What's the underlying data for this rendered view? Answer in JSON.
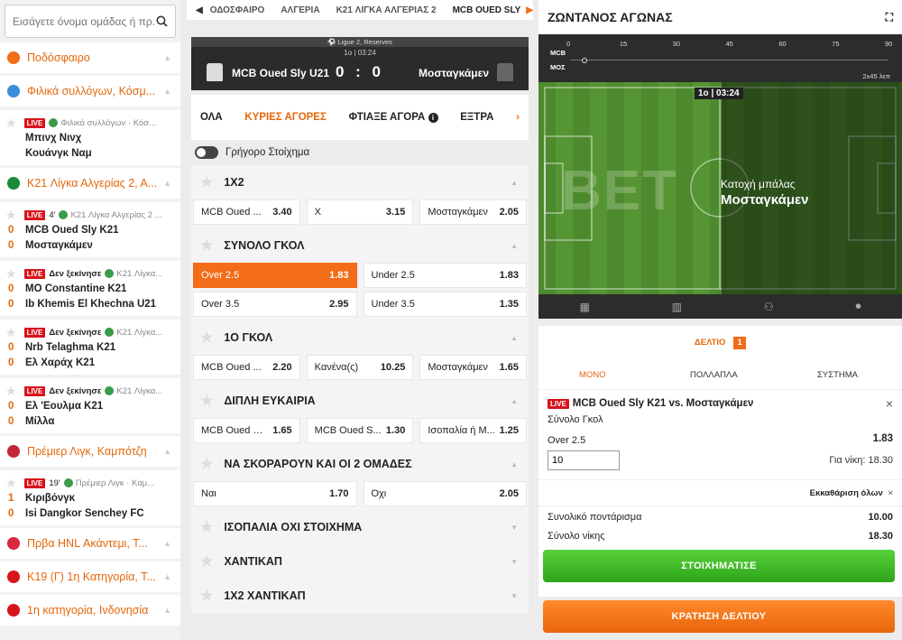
{
  "search": {
    "placeholder": "Εισάγετε όνομα ομάδας ή πρ..."
  },
  "sidebar": [
    {
      "type": "head",
      "label": "Ποδόσφαιρο",
      "color": "#f36c17"
    },
    {
      "type": "head",
      "label": "Φιλικά συλλόγων, Κόσμ...",
      "color": "#3a8fd9"
    },
    {
      "type": "match",
      "live": "LIVE",
      "status": "",
      "minute": "",
      "league": "Φιλικά συλλόγων · Κόσ...",
      "teams": [
        {
          "score": "",
          "name": "Μπινχ Νινχ"
        },
        {
          "score": "",
          "name": "Κουάνγκ Ναμ"
        }
      ]
    },
    {
      "type": "head",
      "label": "K21 Λίγκα Αλγερίας 2, Α...",
      "color": "#1a8a3a"
    },
    {
      "type": "match",
      "live": "LIVE",
      "status": "",
      "minute": "4'",
      "league": "K21 Λίγκα Αλγερίας 2 ...",
      "teams": [
        {
          "score": "0",
          "name": "MCB Oued Sly K21"
        },
        {
          "score": "0",
          "name": "Μοσταγκάμεν"
        }
      ]
    },
    {
      "type": "match",
      "live": "LIVE",
      "status": "Δεν ξεκίνησε",
      "minute": "",
      "league": "K21 Λίγκα...",
      "teams": [
        {
          "score": "0",
          "name": "MO Constantine K21"
        },
        {
          "score": "0",
          "name": "Ib Khemis El Khechna U21"
        }
      ]
    },
    {
      "type": "match",
      "live": "LIVE",
      "status": "Δεν ξεκίνησε",
      "minute": "",
      "league": "K21 Λίγκα...",
      "teams": [
        {
          "score": "0",
          "name": "Nrb Telaghma K21"
        },
        {
          "score": "0",
          "name": "Ελ Χαράχ K21"
        }
      ]
    },
    {
      "type": "match",
      "live": "LIVE",
      "status": "Δεν ξεκίνησε",
      "minute": "",
      "league": "K21 Λίγκα...",
      "teams": [
        {
          "score": "0",
          "name": "Ελ 'Εουλμα K21"
        },
        {
          "score": "0",
          "name": "Μίλλα"
        }
      ]
    },
    {
      "type": "head",
      "label": "Πρέμιερ Λιγκ, Καμπότζη",
      "color": "#c3283a"
    },
    {
      "type": "match",
      "live": "LIVE",
      "status": "",
      "minute": "19'",
      "league": "Πρέμιερ Λιγκ · Καμ...",
      "teams": [
        {
          "score": "1",
          "name": "Κιριβόνγκ"
        },
        {
          "score": "0",
          "name": "Isi Dangkor Senchey FC"
        }
      ]
    },
    {
      "type": "head",
      "label": "Πρβα HNL Ακάντεμι, Τ...",
      "color": "#d8263c"
    },
    {
      "type": "head",
      "label": "K19 (Γ) 1η Κατηγορία, Τ...",
      "color": "#d7141a"
    },
    {
      "type": "head",
      "label": "1η κατηγορία, Ινδονησία",
      "color": "#d7141a"
    }
  ],
  "breadcrumb": [
    "ΟΔΟΣΦΑΙΡΟ",
    "ΑΛΓΕΡΙΑ",
    "K21 ΛΙΓΚΑ ΑΛΓΕΡΙΑΣ 2",
    "MCB OUED SLY"
  ],
  "scoreboard": {
    "league": "Ligue 2, Reserves",
    "time": "1ο | 03:24",
    "home": "MCB Oued Sly U21",
    "score": "0 : 0",
    "away": "Μοσταγκάμεν"
  },
  "tabs": [
    "ΟΛΑ",
    "ΚΥΡΙΕΣ ΑΓΟΡΕΣ",
    "ΦΤΙΑΞΕ ΑΓΟΡΑ",
    "ΕΞΤΡΑ"
  ],
  "quick_bet_label": "Γρήγορο Στοίχημα",
  "markets": [
    {
      "title": "1Χ2",
      "rows": [
        [
          [
            "MCB Oued ...",
            "3.40"
          ],
          [
            "X",
            "3.15"
          ],
          [
            "Μοσταγκάμεν",
            "2.05"
          ]
        ]
      ]
    },
    {
      "title": "ΣΥΝΟΛΟ ΓΚΟΛ",
      "rows": [
        [
          [
            "Over 2.5",
            "1.83"
          ],
          [
            "Under 2.5",
            "1.83"
          ]
        ],
        [
          [
            "Over 3.5",
            "2.95"
          ],
          [
            "Under 3.5",
            "1.35"
          ]
        ]
      ]
    },
    {
      "title": "1Ο ΓΚΟΛ",
      "rows": [
        [
          [
            "MCB Oued ...",
            "2.20"
          ],
          [
            "Κανένα(ς)",
            "10.25"
          ],
          [
            "Μοσταγκάμεν",
            "1.65"
          ]
        ]
      ]
    },
    {
      "title": "ΔΙΠΛΗ ΕΥΚΑΙΡΙΑ",
      "rows": [
        [
          [
            "MCB Oued Sl...",
            "1.65"
          ],
          [
            "MCB Oued S...",
            "1.30"
          ],
          [
            "Ισοπαλία ή M...",
            "1.25"
          ]
        ]
      ]
    },
    {
      "title": "ΝΑ ΣΚΟΡΑΡΟΥΝ ΚΑΙ ΟΙ 2 ΟΜΑΔΕΣ",
      "rows": [
        [
          [
            "Ναι",
            "1.70"
          ],
          [
            "Όχι",
            "2.05"
          ]
        ]
      ]
    },
    {
      "title": "ΙΣΟΠΑΛΙΑ ΟΧΙ ΣΤΟΙΧΗΜΑ",
      "rows": []
    },
    {
      "title": "ΧΑΝΤΙΚΑΠ",
      "rows": []
    },
    {
      "title": "1Χ2 ΧΑΝΤΙΚΑΠ",
      "rows": []
    }
  ],
  "live": {
    "title": "ΖΩΝΤΑΝΟΣ ΑΓΩΝΑΣ",
    "home_abbr": "MCB",
    "away_abbr": "ΜΟΣ",
    "ticks": [
      "0",
      "15",
      "30",
      "45",
      "60",
      "75",
      "90"
    ],
    "period_note": "2x45 λεπ",
    "clock": "1ο | 03:24",
    "possession_label": "Κατοχή μπάλας",
    "possession_team": "Μοσταγκάμεν"
  },
  "slip": {
    "title": "ΔΕΛΤΙΟ",
    "count": "1",
    "tabs": [
      "ΜΟΝΟ",
      "ΠΟΛΛΑΠΛΑ",
      "ΣΥΣΤΗΜΑ"
    ],
    "live": "LIVE",
    "match": "MCB Oued Sly K21 vs. Μοσταγκάμεν",
    "market": "Σύνολο Γκολ",
    "selection": "Over 2.5",
    "odds": "1.83",
    "stake": "10",
    "win_label": "Για νίκη: 18.30",
    "clear": "Εκκαθάριση όλων",
    "total_stake_label": "Συνολικό ποντάρισμα",
    "total_stake": "10.00",
    "total_win_label": "Σύνολο νίκης",
    "total_win": "18.30",
    "bet_button": "ΣΤΟΙΧΗΜΑΤΙΣΕ",
    "save_button": "ΚΡΑΤΗΣΗ ΔΕΛΤΙΟΥ"
  }
}
